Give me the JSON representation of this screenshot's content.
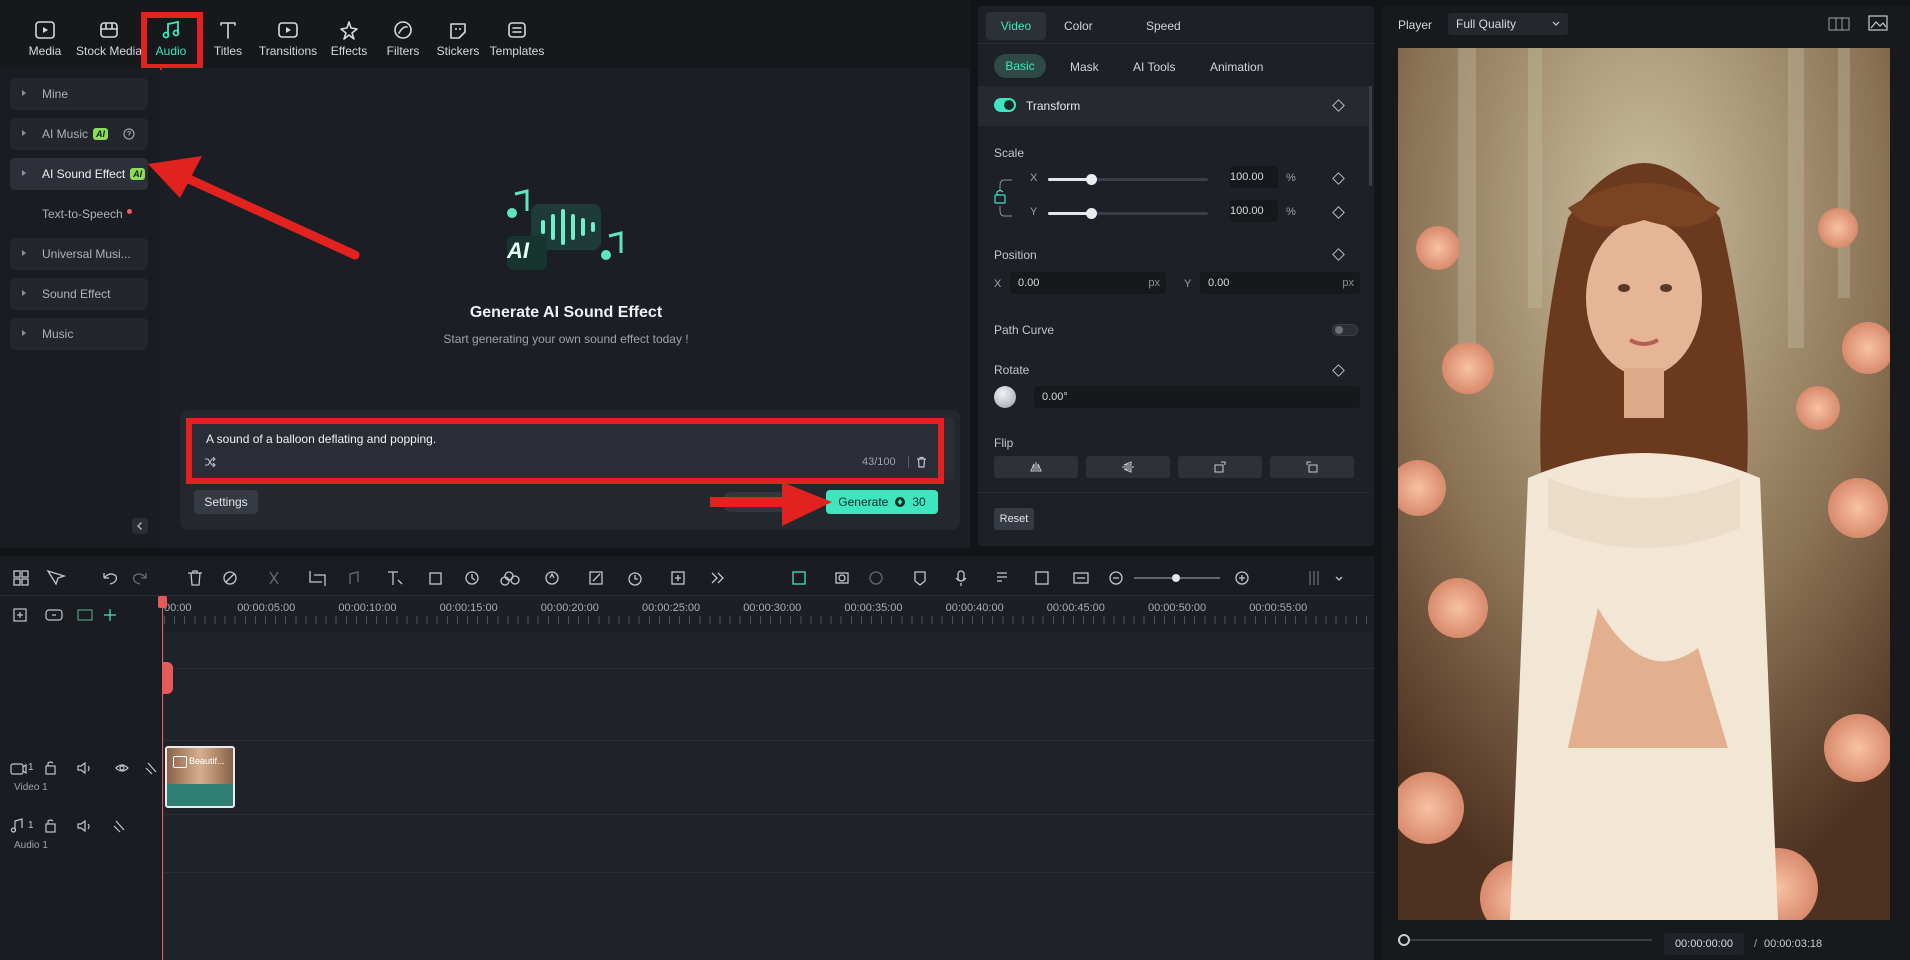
{
  "toolbar": {
    "items": [
      {
        "label": "Media",
        "icon": "media-icon"
      },
      {
        "label": "Stock Media",
        "icon": "stock-media-icon"
      },
      {
        "label": "Audio",
        "icon": "music-note-icon"
      },
      {
        "label": "Titles",
        "icon": "titles-icon"
      },
      {
        "label": "Transitions",
        "icon": "transitions-icon"
      },
      {
        "label": "Effects",
        "icon": "effects-icon"
      },
      {
        "label": "Filters",
        "icon": "filters-icon"
      },
      {
        "label": "Stickers",
        "icon": "stickers-icon"
      },
      {
        "label": "Templates",
        "icon": "templates-icon"
      }
    ],
    "active": "Audio"
  },
  "sidebar": {
    "items": [
      {
        "label": "Mine"
      },
      {
        "label": "AI Music",
        "badge": "AI"
      },
      {
        "label": "AI Sound Effect",
        "badge": "AI"
      },
      {
        "label": "Text-to-Speech"
      },
      {
        "label": "Universal Musi..."
      },
      {
        "label": "Sound Effect"
      },
      {
        "label": "Music"
      }
    ]
  },
  "generator": {
    "title": "Generate AI Sound Effect",
    "subtitle": "Start generating your own sound effect today !",
    "prompt": "A sound of a balloon deflating and popping.",
    "char_count": "43/100",
    "settings_label": "Settings",
    "generate_label": "Generate",
    "credits": "30",
    "logo_text": "AI"
  },
  "properties": {
    "tabs": [
      "Video",
      "Color",
      "Speed"
    ],
    "subtabs": [
      "Basic",
      "Mask",
      "AI Tools",
      "Animation"
    ],
    "transform_label": "Transform",
    "scale_label": "Scale",
    "scale_x_label": "X",
    "scale_y_label": "Y",
    "scale_x": "100.00",
    "scale_y": "100.00",
    "scale_unit": "%",
    "scale_level": 0.27,
    "position_label": "Position",
    "pos_x_label": "X",
    "pos_y_label": "Y",
    "pos_x": "0.00",
    "pos_y": "0.00",
    "pos_unit": "px",
    "path_curve_label": "Path Curve",
    "rotate_label": "Rotate",
    "rotate_value": "0.00°",
    "flip_label": "Flip",
    "reset_label": "Reset"
  },
  "player": {
    "label": "Player",
    "quality": "Full Quality",
    "current_time": "00:00:00:00",
    "separator": "/",
    "total_time": "00:00:03:18",
    "progress": 0
  },
  "timeline": {
    "ruler": [
      "00:00",
      "00:00:05:00",
      "00:00:10:00",
      "00:00:15:00",
      "00:00:20:00",
      "00:00:25:00",
      "00:00:30:00",
      "00:00:35:00",
      "00:00:40:00",
      "00:00:45:00",
      "00:00:50:00",
      "00:00:55:00"
    ],
    "video_track": {
      "number": "1",
      "label": "Video 1"
    },
    "audio_track": {
      "number": "1",
      "label": "Audio 1"
    },
    "clip_label": "Beautif..."
  },
  "colors": {
    "accent": "#3ee6bf",
    "annotation": "#e1221f",
    "ai_badge": "#8ddc59"
  }
}
